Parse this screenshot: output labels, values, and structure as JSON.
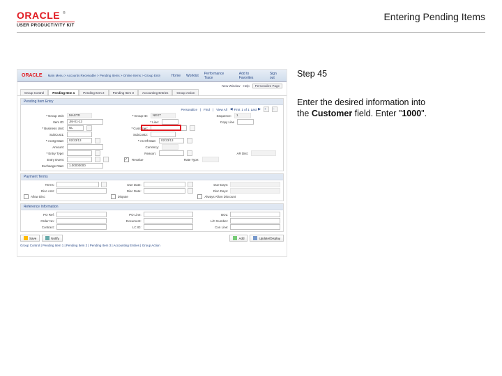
{
  "header": {
    "brand_word": "ORACLE",
    "brand_reg": "®",
    "brand_kit": "USER PRODUCTIVITY KIT",
    "doc_title": "Entering Pending Items"
  },
  "instructions": {
    "step_label": "Step 45",
    "line1": "Enter the desired information into",
    "line2a": "the ",
    "field_name": "Customer",
    "line2b": " field. Enter \"",
    "value": "1000",
    "line2c": "\"."
  },
  "shot": {
    "logo": "ORACLE",
    "breadcrumb": "Main Menu > Accounts Receivable > Pending Items > Online Items > Group Entry",
    "top_links": {
      "home": "Home",
      "worklist": "Worklist",
      "perf": "Performance Trace",
      "addfav": "Add to Favorites",
      "signout": "Sign out"
    },
    "meta": {
      "newwin": "New Window",
      "help": "Help",
      "personalize": "Personalize Page"
    },
    "tabs": [
      "Group Control",
      "Pending Item 1",
      "Pending Item 2",
      "Pending Item 3",
      "Accounting Entries",
      "Group Action"
    ],
    "active_tab": 1,
    "sections": {
      "pending_item_entry": "Pending Item Entry",
      "payment_terms": "Payment Terms",
      "reference_information": "Reference Information"
    },
    "toolbar": {
      "personalize": "Personalize",
      "find": "Find",
      "viewall": "View All",
      "first": "First",
      "range": "1 of 1",
      "last": "Last"
    },
    "form": {
      "group_unit": {
        "label": "Group Unit:",
        "value": "MASTR"
      },
      "group_id": {
        "label": "Group ID:",
        "value": "NEXT"
      },
      "sequence": {
        "label": "Sequence:",
        "value": "1"
      },
      "item_id": {
        "label": "Item ID:",
        "value": "JM-01-13"
      },
      "line": {
        "label": "Line:"
      },
      "copy_line": {
        "label": "Copy Line"
      },
      "customer": {
        "label": "Customer:"
      },
      "business_unit": {
        "label": "Business Unit:",
        "value": "NL"
      },
      "subcust1": {
        "label": "SubCust1:"
      },
      "subcust2": {
        "label": "SubCust2:"
      },
      "acctg_date": {
        "label": "Acctg Date:",
        "value": "02/23/13"
      },
      "asof_date": {
        "label": "As Of Date:",
        "value": "02/23/13"
      },
      "amount": {
        "label": "Amount:"
      },
      "currency": {
        "label": "Currency:"
      },
      "entry_type": {
        "label": "Entry Type:"
      },
      "reason": {
        "label": "Reason:"
      },
      "ar_dist": {
        "label": "AR Dist:"
      },
      "entry_event": {
        "label": "Entry Event:"
      },
      "revalue": {
        "label": "Revalue"
      },
      "rate_type": {
        "label": "Rate Type:"
      },
      "exchange_rate": {
        "label": "Exchange Rate:",
        "value": "1.00000000"
      }
    },
    "payment_terms": {
      "terms": "Terms:",
      "due_date": "Due Date:",
      "due_days": "Due Days:",
      "disc_amt": "Disc Amt:",
      "disc_date": "Disc Date:",
      "disc_days": "Disc Days:",
      "allow_disc": "Allow Disc",
      "dispute": "Dispute",
      "always_allow_disc": "Always Allow Discount"
    },
    "reference": {
      "po_ref": "PO Ref:",
      "po_line": "PO Line:",
      "bol": "BOL:",
      "order_no": "Order No:",
      "document": "Document:",
      "lc_number": "L/C Number:",
      "contract": "Contract:",
      "lc_id": "LC ID:",
      "con_line": "Con Line:"
    },
    "footer": {
      "save": "Save",
      "notify": "Notify",
      "add": "Add",
      "update": "Update/Display",
      "links": "Group Control | Pending Item 1 | Pending Item 2 | Pending Item 3 | Accounting Entries | Group Action"
    }
  }
}
